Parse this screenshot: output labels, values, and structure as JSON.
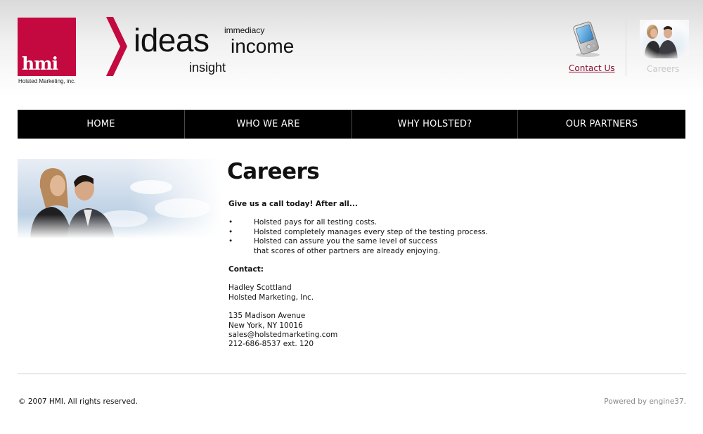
{
  "header": {
    "logo_text": "hmi",
    "logo_caption": "Holsted Marketing, inc.",
    "tagline": {
      "ideas": "ideas",
      "immediacy": "immediacy",
      "income": "income",
      "insight": "insight"
    },
    "contact_link": "Contact Us",
    "careers_link": "Careers",
    "icons": [
      "phone-icon",
      "careers-photo"
    ]
  },
  "nav": {
    "items": [
      {
        "label": "HOME"
      },
      {
        "label": "WHO WE ARE"
      },
      {
        "label": "WHY HOLSTED?"
      },
      {
        "label": "OUR PARTNERS"
      }
    ]
  },
  "main": {
    "title": "Careers",
    "intro": "Give us a call today! After all...",
    "bullets": [
      {
        "line1": "Holsted pays for all testing costs.",
        "line2": ""
      },
      {
        "line1": "Holsted completely manages every step of the testing process.",
        "line2": ""
      },
      {
        "line1": "Holsted can assure you the same level of success",
        "line2": "that scores of other partners are already enjoying."
      }
    ],
    "contact_heading": "Contact:",
    "contact": {
      "name": "Hadley Scottland",
      "company": "Holsted Marketing, Inc.",
      "street": "135 Madison Avenue",
      "city": "New York, NY 10016",
      "email": "sales@holstedmarketing.com",
      "phone": "212-686-8537 ext. 120"
    }
  },
  "footer": {
    "copyright": "© 2007 HMI. All rights reserved.",
    "powered_by": "Powered by engine37."
  },
  "colors": {
    "brand": "#c3093f",
    "nav_bg": "#000000",
    "link": "#8a0f2d"
  }
}
